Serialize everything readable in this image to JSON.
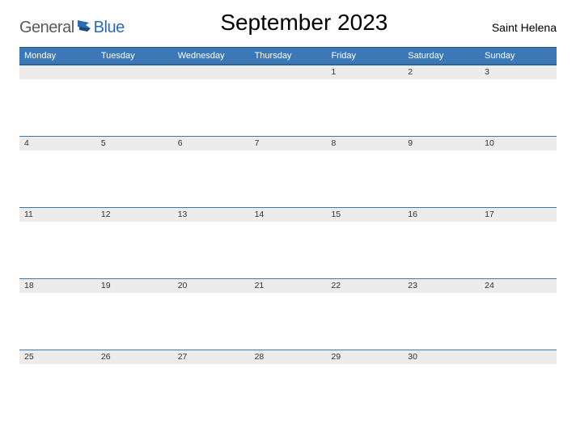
{
  "logo": {
    "part1": "General",
    "part2": "Blue"
  },
  "title": "September 2023",
  "region": "Saint Helena",
  "days_of_week": [
    "Monday",
    "Tuesday",
    "Wednesday",
    "Thursday",
    "Friday",
    "Saturday",
    "Sunday"
  ],
  "weeks": [
    [
      "",
      "",
      "",
      "",
      "1",
      "2",
      "3"
    ],
    [
      "4",
      "5",
      "6",
      "7",
      "8",
      "9",
      "10"
    ],
    [
      "11",
      "12",
      "13",
      "14",
      "15",
      "16",
      "17"
    ],
    [
      "18",
      "19",
      "20",
      "21",
      "22",
      "23",
      "24"
    ],
    [
      "25",
      "26",
      "27",
      "28",
      "29",
      "30",
      ""
    ]
  ]
}
